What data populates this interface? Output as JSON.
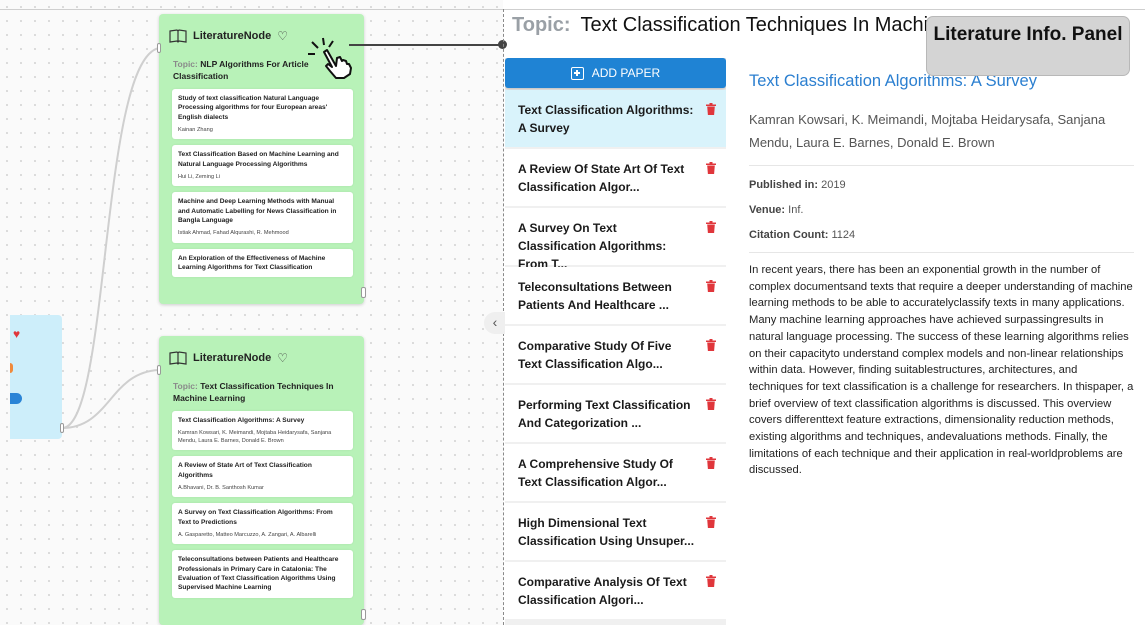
{
  "canvas": {
    "node1": {
      "title": "LiteratureNode",
      "topic_label": "Topic:",
      "topic": "NLP Algorithms For Article Classification",
      "papers": [
        {
          "title": "Study of text classification Natural Language Processing algorithms for four European areas' English dialects",
          "authors": "Kainan Zhang"
        },
        {
          "title": "Text Classification Based on Machine Learning and Natural Language Processing Algorithms",
          "authors": "Hui Li, Zeming Li"
        },
        {
          "title": "Machine and Deep Learning Methods with Manual and Automatic Labelling for News Classification in Bangla Language",
          "authors": "Istiak Ahmad, Fahad Alqurashi, R. Mehmood"
        },
        {
          "title": "An Exploration of the Effectiveness of Machine Learning Algorithms for Text Classification",
          "authors": ""
        }
      ]
    },
    "node2": {
      "title": "LiteratureNode",
      "topic_label": "Topic:",
      "topic": "Text Classification Techniques In Machine Learning",
      "papers": [
        {
          "title": "Text Classification Algorithms: A Survey",
          "authors": "Kamran Kowsari, K. Meimandi, Mojtaba Heidarysafa, Sanjana Mendu, Laura E. Barnes, Donald E. Brown"
        },
        {
          "title": "A Review of State Art of Text Classification Algorithms",
          "authors": "A.Bhavani, Dr. B. Santhosh Kumar"
        },
        {
          "title": "A Survey on Text Classification Algorithms: From Text to Predictions",
          "authors": "A. Gasparetto, Matteo Marcuzzo, A. Zangari, A. Albarelli"
        },
        {
          "title": "Teleconsultations between Patients and Healthcare Professionals in Primary Care in Catalonia: The Evaluation of Text Classification Algorithms Using Supervised Machine Learning",
          "authors": ""
        }
      ]
    }
  },
  "panel": {
    "topic_label": "Topic:",
    "topic": "Text Classification Techniques In Machi",
    "overlay_label": "Literature Info. Panel",
    "add_button": "ADD PAPER",
    "papers": [
      "Text Classification Algorithms: A Survey",
      "A Review Of State Art Of Text Classification Algor...",
      "A Survey On Text Classification Algorithms: From T...",
      "Teleconsultations Between Patients And Healthcare ...",
      "Comparative Study Of Five Text Classification Algo...",
      "Performing Text Classification And Categorization ...",
      "A Comprehensive Study Of Text Classification Algor...",
      "High Dimensional Text Classification Using Unsuper...",
      "Comparative Analysis Of Text Classification Algori..."
    ],
    "detail": {
      "title": "Text Classification Algorithms: A Survey",
      "authors": "Kamran Kowsari, K. Meimandi, Mojtaba Heidarysafa, Sanjana Mendu, Laura E. Barnes, Donald E. Brown",
      "published_label": "Published in:",
      "published": "2019",
      "venue_label": "Venue:",
      "venue": "Inf.",
      "citation_label": "Citation Count:",
      "citation": "1124",
      "abstract": "In recent years, there has been an exponential growth in the number of complex documentsand texts that require a deeper understanding of machine learning methods to be able to accuratelyclassify texts in many applications. Many machine learning approaches have achieved surpassingresults in natural language processing. The success of these learning algorithms relies on their capacityto understand complex models and non-linear relationships within data. However, finding suitablestructures, architectures, and techniques for text classification is a challenge for researchers. In thispaper, a brief overview of text classification algorithms is discussed. This overview covers differenttext feature extractions, dimensionality reduction methods, existing algorithms and techniques, andevaluations methods. Finally, the limitations of each technique and their application in real-worldproblems are discussed."
    }
  },
  "colors": {
    "node_green": "#b8f2b8",
    "accent_blue": "#1f83d4",
    "link_blue": "#2b7fd0",
    "selected_bg": "#d9f3fb",
    "delete_red": "#e0363b"
  },
  "icons": [
    "book-icon",
    "heart-icon",
    "pointer-hand-icon",
    "add-box-icon",
    "trash-icon",
    "chevron-left-icon"
  ]
}
